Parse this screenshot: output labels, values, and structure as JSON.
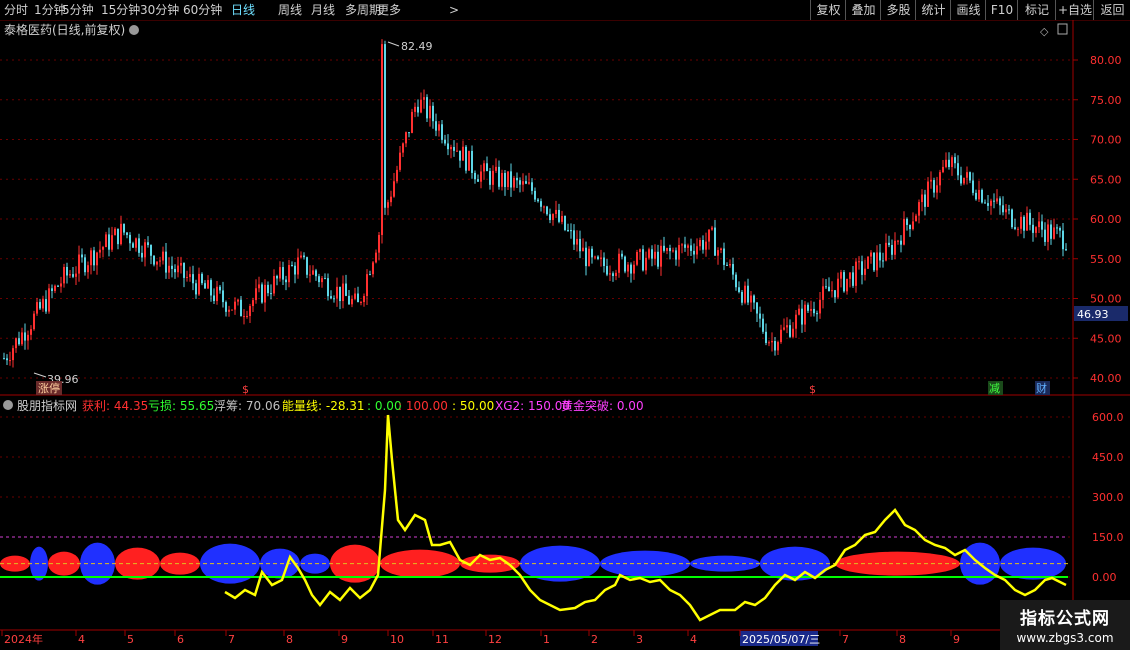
{
  "toolbar": {
    "periods": [
      "分时",
      "1分钟",
      "5分钟",
      "15分钟",
      "30分钟",
      "60分钟",
      "日线",
      "周线",
      "月线",
      "多周期",
      "更多"
    ],
    "active_period": "日线",
    "more_arrow": ">",
    "right_buttons": [
      "复权",
      "叠加",
      "多股",
      "统计",
      "画线",
      "F10",
      "标记",
      "+自选",
      "返回"
    ]
  },
  "main_chart": {
    "title": "泰格医药(日线,前复权)",
    "high_label": "82.49",
    "low_label": "39.96",
    "current_price": "46.93",
    "y_ticks": [
      "80.00",
      "75.00",
      "70.00",
      "65.00",
      "60.00",
      "55.00",
      "50.00",
      "45.00",
      "40.00"
    ],
    "markers": [
      {
        "text": "涨停",
        "color": "#ff4040"
      },
      {
        "text": "$",
        "color": "#ff4040"
      },
      {
        "text": "$",
        "color": "#ff4040"
      },
      {
        "text": "减",
        "color": "#40ff40"
      },
      {
        "text": "财",
        "color": "#40a0ff"
      }
    ]
  },
  "indicator": {
    "name": "股朋指标网",
    "values": [
      {
        "label": "获利: 44.35",
        "color": "#ff3030"
      },
      {
        "label": "亏损: 55.65",
        "color": "#30ff30"
      },
      {
        "label": "浮筹: 70.06",
        "color": "#c0c0c0"
      },
      {
        "label": "能量线: -28.31",
        "color": "#ffff00"
      },
      {
        "label": ": 0.00",
        "color": "#30ff30"
      },
      {
        "label": ": 100.00",
        "color": "#ff3030"
      },
      {
        "label": ": 50.00",
        "color": "#ffff00"
      },
      {
        "label": "XG2: 150.00",
        "color": "#ff40ff"
      },
      {
        "label": "黄金突破: 0.00",
        "color": "#ff40ff"
      }
    ],
    "y_ticks": [
      "600.0",
      "450.0",
      "300.0",
      "150.0",
      "0.00"
    ]
  },
  "x_axis": {
    "labels": [
      "2024年",
      "4",
      "5",
      "6",
      "7",
      "8",
      "9",
      "10",
      "11",
      "12",
      "1",
      "2",
      "3",
      "4",
      "2025/05/07/三",
      "7",
      "8",
      "9"
    ]
  },
  "watermark": {
    "title": "指标公式网",
    "url": "www.zbgs3.com"
  },
  "chart_data": {
    "type": "line",
    "title": "泰格医药(日线,前复权)",
    "price_range": [
      39.96,
      82.49
    ],
    "x": [
      "2024-03",
      "2024-04",
      "2024-05",
      "2024-06",
      "2024-07",
      "2024-08",
      "2024-09",
      "2024-10",
      "2024-11",
      "2024-12",
      "2025-01",
      "2025-02",
      "2025-03",
      "2025-04",
      "2025-05",
      "2025-06",
      "2025-07",
      "2025-08",
      "2025-09"
    ],
    "series": [
      {
        "name": "",
        "values": [
          42.5,
          52.5,
          58.5,
          53.0,
          48.5,
          54.5,
          49.0,
          75.0,
          66.0,
          63.5,
          54.0,
          55.0,
          57.5,
          44.5,
          51.0,
          56.0,
          67.0,
          60.5,
          57.5
        ]
      }
    ],
    "indicator_range": [
      -100,
      650
    ],
    "indicator_series": [
      {
        "name": "能量线",
        "values": [
          null,
          null,
          -60,
          30,
          -40,
          -20,
          600,
          120,
          60,
          -20,
          -60,
          -40,
          10,
          -80,
          -40,
          30,
          180,
          60,
          -28.31
        ]
      }
    ]
  },
  "colors": {
    "up": "#ff3030",
    "down": "#5ed8e8",
    "energy": "#ffff00",
    "grid": "#7a0000",
    "axis": "#ff3030"
  }
}
